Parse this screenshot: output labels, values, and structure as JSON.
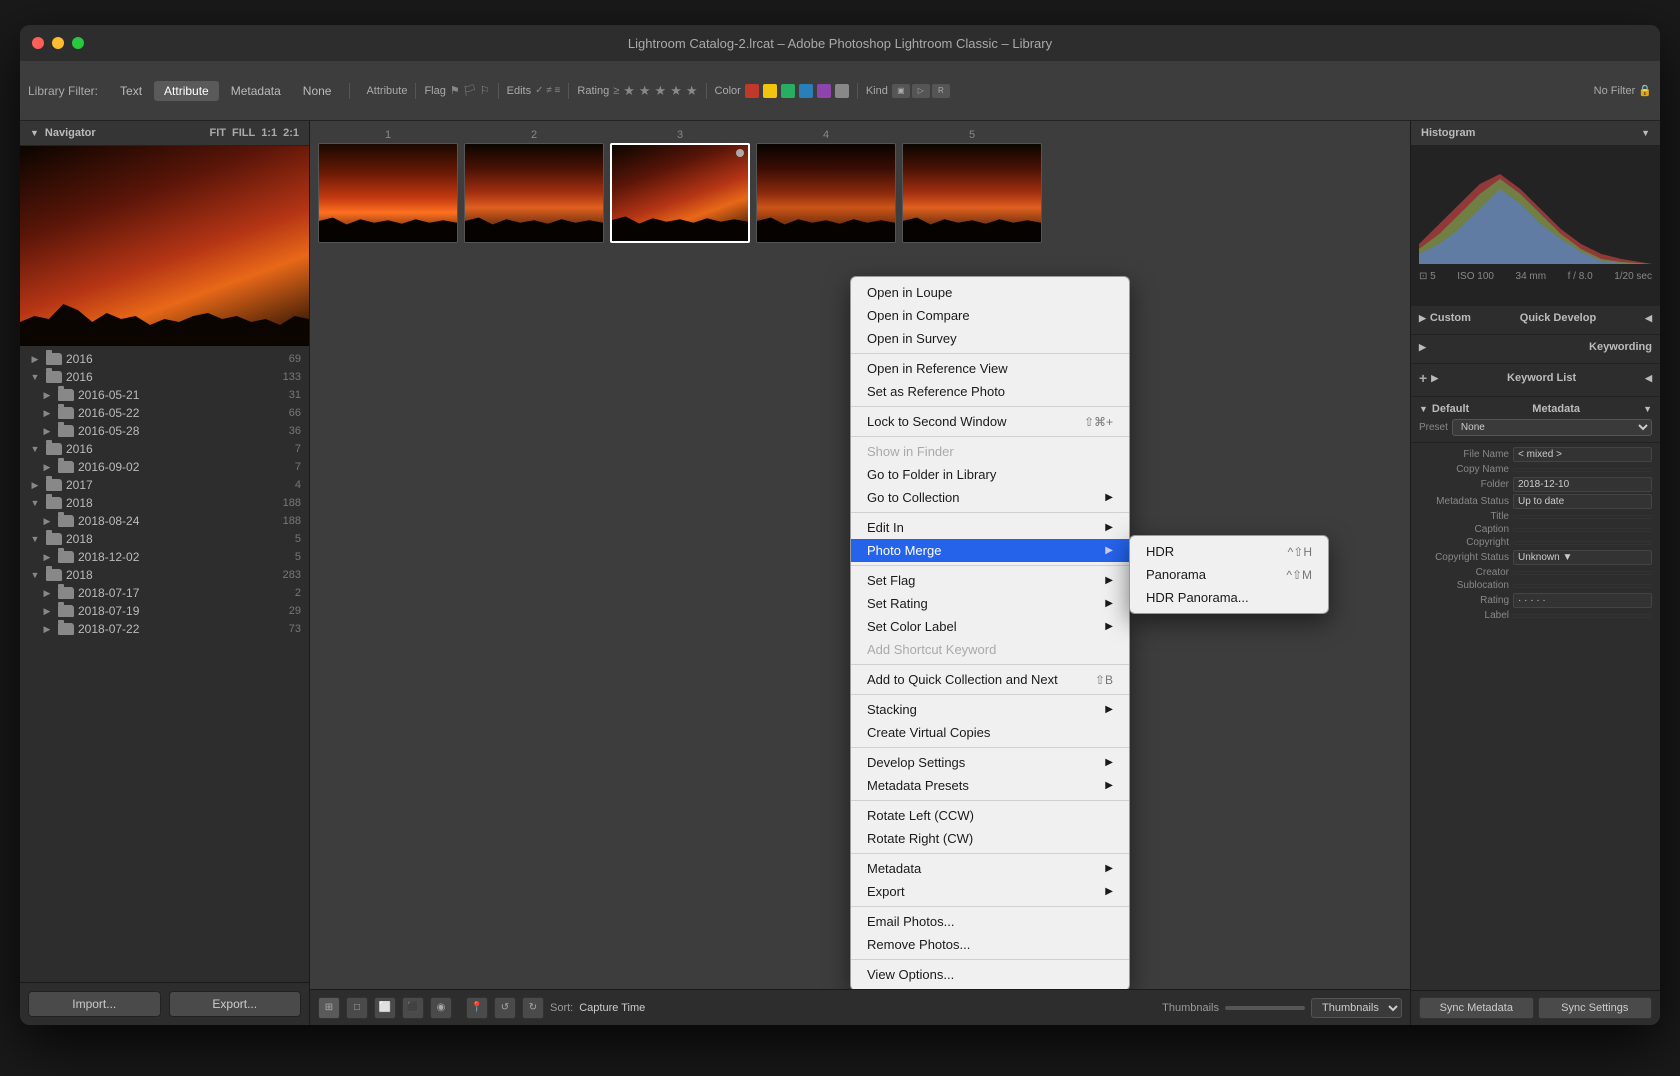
{
  "window": {
    "title": "Lightroom Catalog-2.lrcat – Adobe Photoshop Lightroom Classic – Library",
    "traffic_lights": [
      "close",
      "minimize",
      "maximize"
    ]
  },
  "filter_bar": {
    "label": "Library Filter:",
    "tabs": [
      "Text",
      "Attribute",
      "Metadata",
      "None"
    ],
    "active_tab": "Attribute",
    "attribute_label": "Attribute",
    "flag_label": "Flag",
    "edits_label": "Edits",
    "rating_label": "Rating",
    "color_label": "Color",
    "kind_label": "Kind",
    "no_filter": "No Filter"
  },
  "navigator": {
    "label": "Navigator",
    "fit": "FIT",
    "fill": "FILL",
    "one": "1:1",
    "two": "2:1"
  },
  "folder_tree": {
    "items": [
      {
        "label": "2016",
        "count": "69",
        "level": 0,
        "expanded": false
      },
      {
        "label": "2016",
        "count": "133",
        "level": 0,
        "expanded": true
      },
      {
        "label": "2016-05-21",
        "count": "31",
        "level": 1
      },
      {
        "label": "2016-05-22",
        "count": "66",
        "level": 1
      },
      {
        "label": "2016-05-28",
        "count": "36",
        "level": 1
      },
      {
        "label": "2016",
        "count": "7",
        "level": 0,
        "expanded": true
      },
      {
        "label": "2016-09-02",
        "count": "7",
        "level": 1
      },
      {
        "label": "2017",
        "count": "4",
        "level": 0,
        "expanded": false
      },
      {
        "label": "2018",
        "count": "188",
        "level": 0,
        "expanded": true
      },
      {
        "label": "2018-08-24",
        "count": "188",
        "level": 1
      },
      {
        "label": "2018",
        "count": "5",
        "level": 0,
        "expanded": true
      },
      {
        "label": "2018-12-02",
        "count": "5",
        "level": 1
      },
      {
        "label": "2018",
        "count": "283",
        "level": 0,
        "expanded": true
      },
      {
        "label": "2018-07-17",
        "count": "2",
        "level": 1
      },
      {
        "label": "2018-07-19",
        "count": "29",
        "level": 1
      },
      {
        "label": "2018-07-22",
        "count": "73",
        "level": 1
      }
    ]
  },
  "buttons": {
    "import": "Import...",
    "export": "Export..."
  },
  "thumbnails": [
    {
      "number": "1",
      "class": "photo-sunset1"
    },
    {
      "number": "2",
      "class": "photo-sunset2"
    },
    {
      "number": "3",
      "class": "photo-sunset3"
    },
    {
      "number": "4",
      "class": "photo-sunset4"
    },
    {
      "number": "5",
      "class": "photo-sunset1"
    }
  ],
  "toolbar": {
    "sort_label": "Sort:",
    "sort_value": "Capture Time",
    "thumbnails_label": "Thumbnails"
  },
  "right_panel": {
    "histogram_label": "Histogram",
    "photo_info": {
      "iso": "ISO 100",
      "focal": "34 mm",
      "aperture": "f / 8.0",
      "shutter": "1/20 sec",
      "frame": "⊡ 5"
    },
    "quick_develop": {
      "label": "Quick Develop",
      "preset_label": "Custom"
    },
    "keywording_label": "Keywording",
    "keyword_list_label": "Keyword List",
    "metadata": {
      "label": "Metadata",
      "preset_label": "Default",
      "preset_value": "None",
      "fields": [
        {
          "label": "File Name",
          "value": "< mixed >"
        },
        {
          "label": "Copy Name",
          "value": ""
        },
        {
          "label": "Folder",
          "value": "2018-12-10"
        },
        {
          "label": "Metadata Status",
          "value": "Up to date"
        },
        {
          "label": "Title",
          "value": ""
        },
        {
          "label": "Caption",
          "value": ""
        },
        {
          "label": "Copyright",
          "value": ""
        },
        {
          "label": "Copyright Status",
          "value": "Unknown"
        },
        {
          "label": "Creator",
          "value": ""
        },
        {
          "label": "Sublocation",
          "value": ""
        },
        {
          "label": "Rating",
          "value": "· · · · ·"
        },
        {
          "label": "Label",
          "value": ""
        }
      ]
    },
    "sync_metadata": "Sync Metadata",
    "sync_settings": "Sync Settings"
  },
  "context_menu": {
    "items": [
      {
        "label": "Open in Loupe",
        "type": "item"
      },
      {
        "label": "Open in Compare",
        "type": "item"
      },
      {
        "label": "Open in Survey",
        "type": "item"
      },
      {
        "type": "separator"
      },
      {
        "label": "Open in Reference View",
        "type": "item"
      },
      {
        "label": "Set as Reference Photo",
        "type": "item"
      },
      {
        "type": "separator"
      },
      {
        "label": "Lock to Second Window",
        "type": "item",
        "shortcut": "⇧⌘+"
      },
      {
        "type": "separator"
      },
      {
        "label": "Show in Finder",
        "type": "item",
        "disabled": true
      },
      {
        "label": "Go to Folder in Library",
        "type": "item"
      },
      {
        "label": "Go to Collection",
        "type": "item",
        "has_arrow": true
      },
      {
        "type": "separator"
      },
      {
        "label": "Edit In",
        "type": "item",
        "has_arrow": true
      },
      {
        "label": "Photo Merge",
        "type": "item",
        "has_arrow": true,
        "highlighted": true
      },
      {
        "type": "separator"
      },
      {
        "label": "Set Flag",
        "type": "item",
        "has_arrow": true
      },
      {
        "label": "Set Rating",
        "type": "item",
        "has_arrow": true
      },
      {
        "label": "Set Color Label",
        "type": "item",
        "has_arrow": true
      },
      {
        "label": "Add Shortcut Keyword",
        "type": "item",
        "disabled": true
      },
      {
        "type": "separator"
      },
      {
        "label": "Add to Quick Collection and Next",
        "type": "item",
        "shortcut": "⇧B"
      },
      {
        "type": "separator"
      },
      {
        "label": "Stacking",
        "type": "item",
        "has_arrow": true
      },
      {
        "label": "Create Virtual Copies",
        "type": "item"
      },
      {
        "type": "separator"
      },
      {
        "label": "Develop Settings",
        "type": "item",
        "has_arrow": true
      },
      {
        "label": "Metadata Presets",
        "type": "item",
        "has_arrow": true
      },
      {
        "type": "separator"
      },
      {
        "label": "Rotate Left (CCW)",
        "type": "item"
      },
      {
        "label": "Rotate Right (CW)",
        "type": "item"
      },
      {
        "type": "separator"
      },
      {
        "label": "Metadata",
        "type": "item",
        "has_arrow": true
      },
      {
        "label": "Export",
        "type": "item",
        "has_arrow": true
      },
      {
        "type": "separator"
      },
      {
        "label": "Email Photos...",
        "type": "item"
      },
      {
        "label": "Remove Photos...",
        "type": "item"
      },
      {
        "type": "separator"
      },
      {
        "label": "View Options...",
        "type": "item"
      }
    ],
    "submenu": {
      "items": [
        {
          "label": "HDR",
          "shortcut": "^⇧H"
        },
        {
          "label": "Panorama",
          "shortcut": "^⇧M"
        },
        {
          "label": "HDR Panorama...",
          "shortcut": ""
        }
      ]
    }
  }
}
